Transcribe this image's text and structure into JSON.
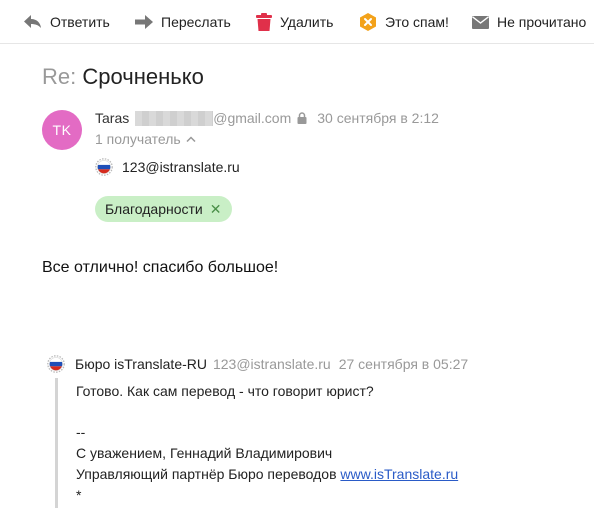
{
  "toolbar": {
    "reply": "Ответить",
    "forward": "Переслать",
    "delete": "Удалить",
    "spam": "Это спам!",
    "unread": "Не прочитано"
  },
  "message": {
    "subject_prefix": "Re:",
    "subject": "Срочненько",
    "avatar_initials": "TK",
    "sender_name": "Taras",
    "sender_domain": "@gmail.com",
    "date": "30 сентября в 2:12",
    "recipients_count": "1 получатель",
    "recipient_address": "123@istranslate.ru",
    "label_tag": "Благодарности",
    "body": "Все отлично! спасибо большое!"
  },
  "quoted": {
    "sender_name": "Бюро isTranslate-RU",
    "sender_email": "123@istranslate.ru",
    "date": "27 сентября в 05:27",
    "line1": "Готово. Как сам перевод - что говорит юрист?",
    "separator": "--",
    "signature1": "С уважением, Геннадий Владимирович",
    "signature2_prefix": "Управляющий партнёр Бюро переводов",
    "signature_link": "www.isTranslate.ru",
    "trailing": "*"
  },
  "colors": {
    "avatar": "#e36bc4",
    "tag_bg": "#c9efc6",
    "link": "#2a5bc7",
    "spam_icon": "#f3a21a",
    "delete_icon": "#e0304a"
  }
}
